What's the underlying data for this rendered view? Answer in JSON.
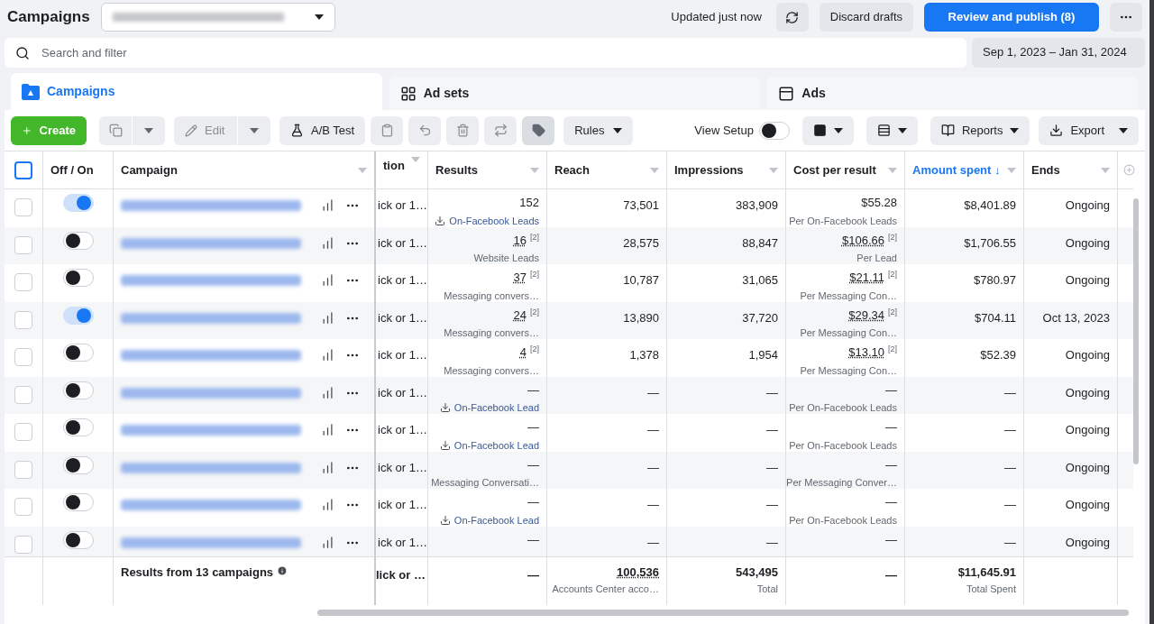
{
  "header": {
    "title": "Campaigns",
    "status": "Updated just now",
    "discard": "Discard drafts",
    "publish": "Review and publish (8)"
  },
  "search": {
    "placeholder": "Search and filter",
    "date_range": "Sep 1, 2023 – Jan 31, 2024"
  },
  "tabs": [
    {
      "label": "Campaigns",
      "selected": true
    },
    {
      "label": "Ad sets",
      "selected": false
    },
    {
      "label": "Ads",
      "selected": false
    }
  ],
  "toolbar": {
    "create": "Create",
    "edit": "Edit",
    "ab_test": "A/B Test",
    "rules": "Rules",
    "view_setup": {
      "label": "View Setup",
      "on": false
    },
    "reports": "Reports",
    "export": "Export"
  },
  "select_all": {
    "checked": false
  },
  "columns": [
    {
      "label": "Off / On",
      "sorted": false
    },
    {
      "label": "Campaign",
      "sorted": false
    },
    {
      "label": "tion",
      "sorted": false
    },
    {
      "label": "Results",
      "sorted": false
    },
    {
      "label": "Reach",
      "sorted": false
    },
    {
      "label": "Impressions",
      "sorted": false
    },
    {
      "label": "Cost per result",
      "sorted": false
    },
    {
      "label": "Amount spent ↓",
      "sorted": true
    },
    {
      "label": "Ends",
      "sorted": false
    }
  ],
  "rows": [
    {
      "checked": false,
      "on": true,
      "delivery": "ick or 1…",
      "results": {
        "value": "152",
        "label": "On-Facebook Leads",
        "kind": "link"
      },
      "reach": "73,501",
      "impressions": "383,909",
      "cost": {
        "value": "$55.28",
        "label": "Per On-Facebook Leads"
      },
      "spent": "$8,401.89",
      "ends": "Ongoing"
    },
    {
      "checked": false,
      "on": false,
      "delivery": "ick or 1…",
      "results": {
        "value": "16",
        "footnote": "[2]",
        "label": "Website Leads",
        "kind": "plain"
      },
      "reach": "28,575",
      "impressions": "88,847",
      "cost": {
        "value": "$106.66",
        "footnote": "[2]",
        "label": "Per Lead"
      },
      "spent": "$1,706.55",
      "ends": "Ongoing"
    },
    {
      "checked": false,
      "on": false,
      "delivery": "ick or 1…",
      "results": {
        "value": "37",
        "footnote": "[2]",
        "label": "Messaging convers…",
        "kind": "plain"
      },
      "reach": "10,787",
      "impressions": "31,065",
      "cost": {
        "value": "$21.11",
        "footnote": "[2]",
        "label": "Per Messaging Con…"
      },
      "spent": "$780.97",
      "ends": "Ongoing"
    },
    {
      "checked": false,
      "on": true,
      "delivery": "ick or 1…",
      "results": {
        "value": "24",
        "footnote": "[2]",
        "label": "Messaging convers…",
        "kind": "plain"
      },
      "reach": "13,890",
      "impressions": "37,720",
      "cost": {
        "value": "$29.34",
        "footnote": "[2]",
        "label": "Per Messaging Con…"
      },
      "spent": "$704.11",
      "ends": "Oct 13, 2023"
    },
    {
      "checked": false,
      "on": false,
      "delivery": "ick or 1…",
      "results": {
        "value": "4",
        "footnote": "[2]",
        "label": "Messaging convers…",
        "kind": "plain"
      },
      "reach": "1,378",
      "impressions": "1,954",
      "cost": {
        "value": "$13.10",
        "footnote": "[2]",
        "label": "Per Messaging Con…"
      },
      "spent": "$52.39",
      "ends": "Ongoing"
    },
    {
      "checked": false,
      "on": false,
      "delivery": "ick or 1…",
      "results": {
        "value": "—",
        "label": "On-Facebook Lead",
        "kind": "link"
      },
      "reach": "—",
      "impressions": "—",
      "cost": {
        "value": "—",
        "label": "Per On-Facebook Leads"
      },
      "spent": "—",
      "ends": "Ongoing"
    },
    {
      "checked": false,
      "on": false,
      "delivery": "ick or 1…",
      "results": {
        "value": "—",
        "label": "On-Facebook Lead",
        "kind": "link"
      },
      "reach": "—",
      "impressions": "—",
      "cost": {
        "value": "—",
        "label": "Per On-Facebook Leads"
      },
      "spent": "—",
      "ends": "Ongoing"
    },
    {
      "checked": false,
      "on": false,
      "delivery": "ick or 1…",
      "results": {
        "value": "—",
        "label": "Messaging Conversati…",
        "kind": "plain"
      },
      "reach": "—",
      "impressions": "—",
      "cost": {
        "value": "—",
        "label": "Per Messaging Conver…"
      },
      "spent": "—",
      "ends": "Ongoing"
    },
    {
      "checked": false,
      "on": false,
      "delivery": "ick or 1…",
      "results": {
        "value": "—",
        "label": "On-Facebook Lead",
        "kind": "link"
      },
      "reach": "—",
      "impressions": "—",
      "cost": {
        "value": "—",
        "label": "Per On-Facebook Leads"
      },
      "spent": "—",
      "ends": "Ongoing"
    },
    {
      "checked": false,
      "on": false,
      "delivery": "ick or 1…",
      "results": {
        "value": "—"
      },
      "reach": "—",
      "impressions": "—",
      "cost": {
        "value": "—"
      },
      "spent": "—",
      "ends": "Ongoing"
    }
  ],
  "footer": {
    "title": "Results from 13 campaigns",
    "delivery": "lick or …",
    "results": "—",
    "reach": {
      "value": "100,536",
      "sub": "Accounts Center acco…"
    },
    "impressions": {
      "value": "543,495",
      "sub": "Total"
    },
    "cost": "—",
    "spent": {
      "value": "$11,645.91",
      "sub": "Total Spent"
    }
  }
}
